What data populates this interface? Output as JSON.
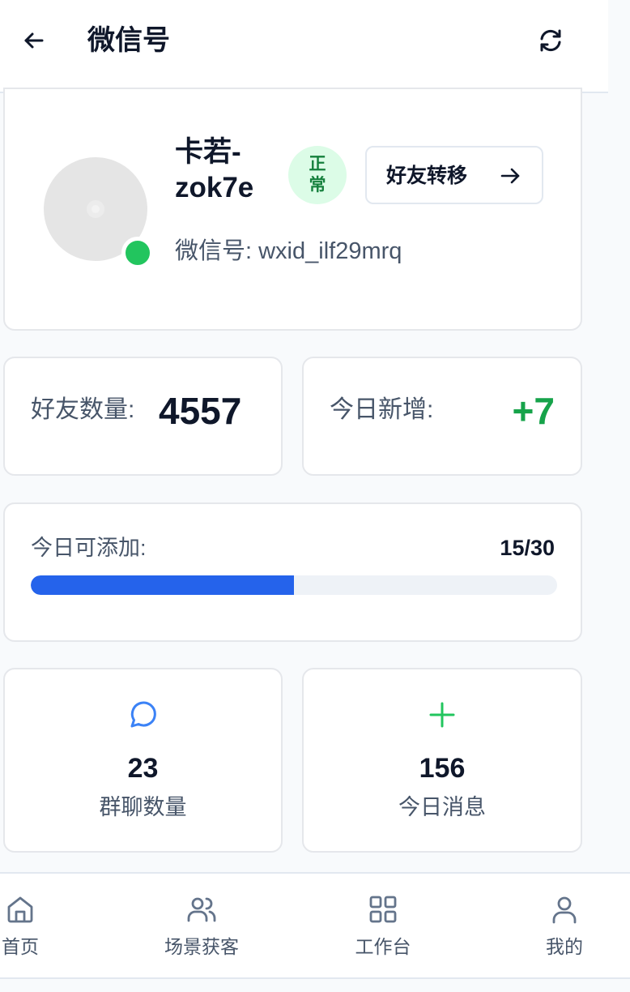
{
  "header": {
    "title": "微信号",
    "back_icon": "arrow-left-icon",
    "refresh_icon": "refresh-icon"
  },
  "account": {
    "name": "卡若-zok7e",
    "status": "正常",
    "online": true,
    "wechat_id_label": "微信号: wxid_ilf29mrq",
    "transfer_button": "好友转移"
  },
  "stats": {
    "friends_label": "好友数量:",
    "friends_value": "4557",
    "new_today_label": "今日新增:",
    "new_today_value": "+7"
  },
  "quota": {
    "label": "今日可添加:",
    "count_text": "15/30",
    "used": 15,
    "total": 30
  },
  "tiles": [
    {
      "icon": "chat-bubble-icon",
      "value": "23",
      "label": "群聊数量"
    },
    {
      "icon": "plus-icon",
      "value": "156",
      "label": "今日消息"
    }
  ],
  "nav": [
    {
      "icon": "home-icon",
      "label": "首页"
    },
    {
      "icon": "users-icon",
      "label": "场景获客"
    },
    {
      "icon": "grid-icon",
      "label": "工作台"
    },
    {
      "icon": "user-icon",
      "label": "我的"
    }
  ],
  "colors": {
    "accent_blue": "#2563eb",
    "online_green": "#22c55e",
    "positive_green": "#16a34a",
    "badge_bg": "#dcfce7"
  }
}
